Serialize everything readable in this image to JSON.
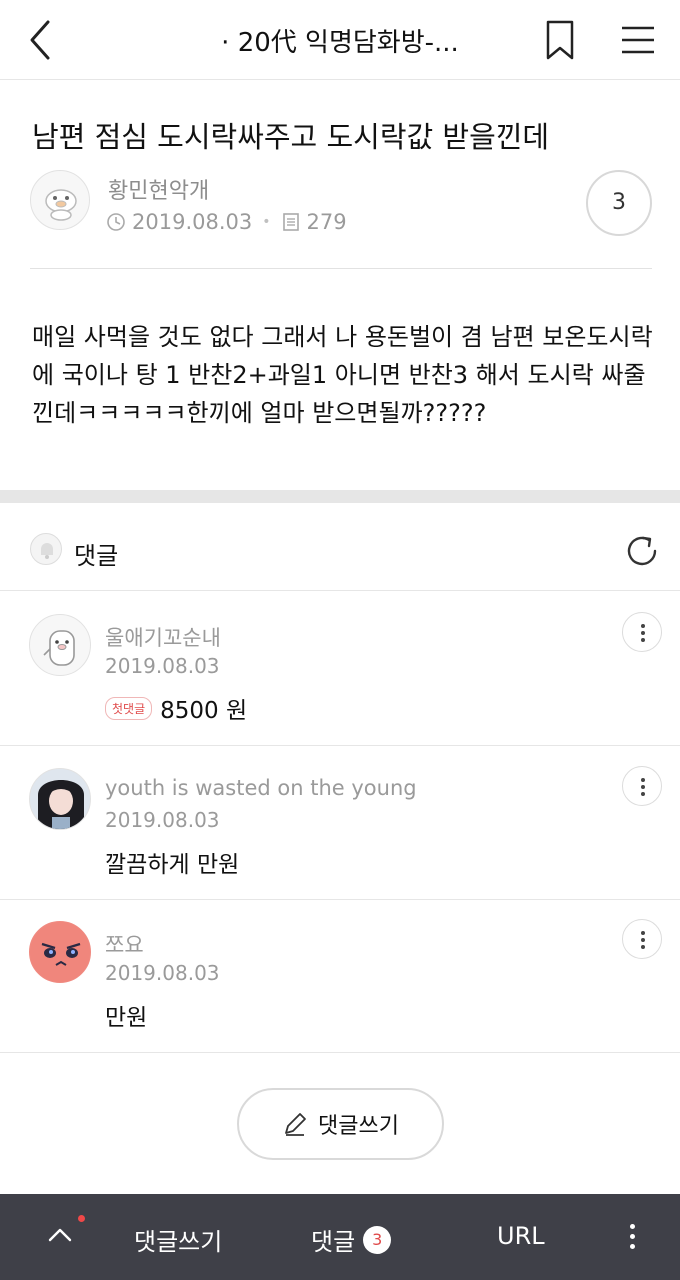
{
  "header": {
    "title": "· 20代 익명담화방-..."
  },
  "post": {
    "title": "남편 점심 도시락싸주고 도시락값 받을낀데",
    "author": "황민현악개",
    "date": "2019.08.03",
    "views": "279",
    "comment_count": "3",
    "body": "매일 사먹을 것도 없다 그래서 나 용돈벌이 겸 남편 보온도시락에 국이나 탕 1 반찬2+과일1 아니면 반찬3 해서 도시락 싸줄낀데ㅋㅋㅋㅋㅋ한끼에 얼마 받으면될까?????"
  },
  "comments_section": {
    "label": "댓글"
  },
  "comments": [
    {
      "name": "울애기꼬순내",
      "date": "2019.08.03",
      "badge": "첫댓글",
      "text": "8500 원"
    },
    {
      "name": "youth is wasted on the young",
      "date": "2019.08.03",
      "text": "깔끔하게 만원"
    },
    {
      "name": "쪼요",
      "date": "2019.08.03",
      "text": "만원"
    }
  ],
  "write_button": {
    "label": "댓글쓰기"
  },
  "bottom_bar": {
    "write_label": "댓글쓰기",
    "comments_label": "댓글",
    "comments_count": "3",
    "url_label": "URL"
  },
  "icons": {
    "back": "chevron-left-icon",
    "bookmark": "bookmark-icon",
    "menu": "hamburger-menu-icon",
    "clock": "clock-icon",
    "views": "document-icon",
    "bell": "bell-icon",
    "refresh": "refresh-icon",
    "pencil": "pencil-icon",
    "more": "vertical-dots-icon"
  },
  "colors": {
    "bottom_bar": "#3f4048",
    "badge_red": "#e04b4b"
  }
}
